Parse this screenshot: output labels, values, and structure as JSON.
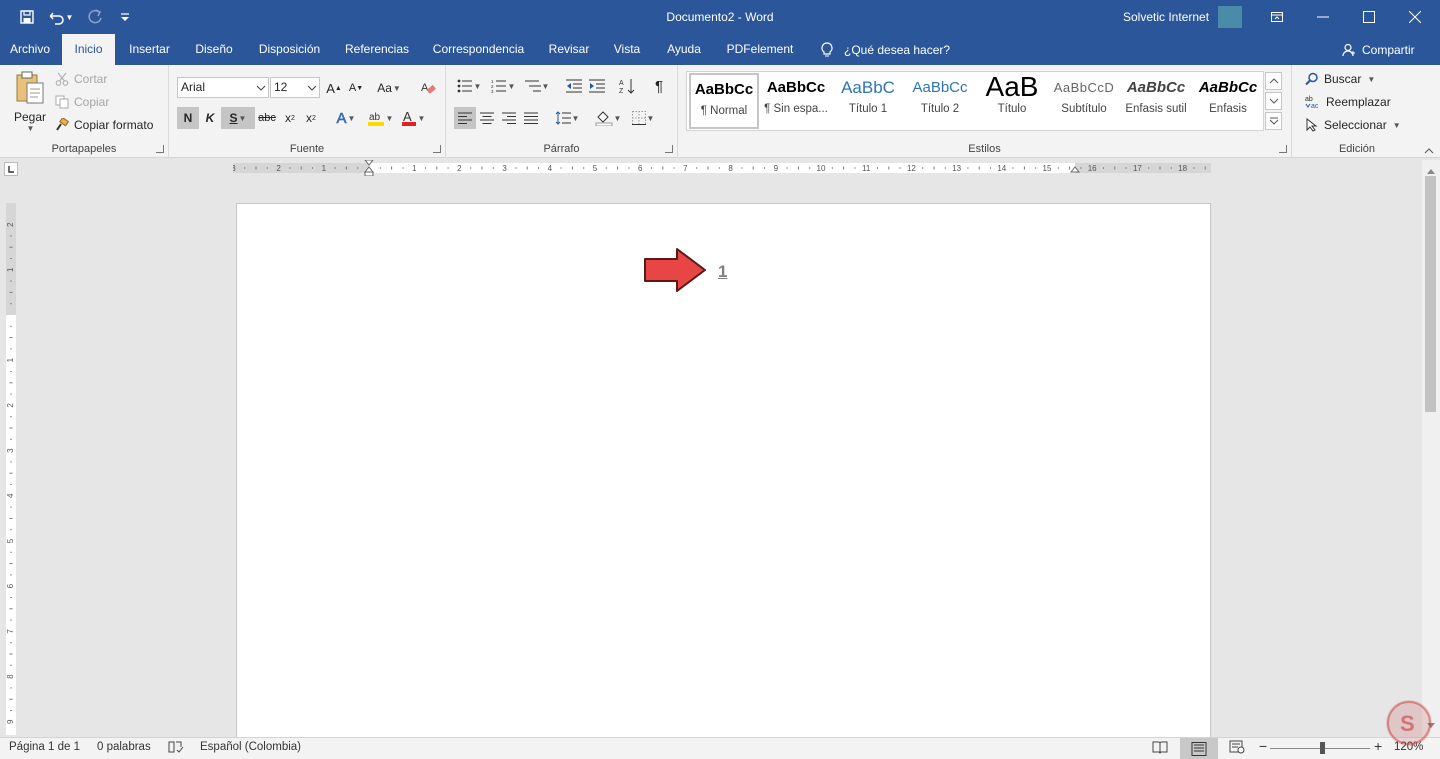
{
  "window": {
    "title": "Documento2 - Word",
    "user": "Solvetic Internet"
  },
  "tabs": [
    "Archivo",
    "Inicio",
    "Insertar",
    "Diseño",
    "Disposición",
    "Referencias",
    "Correspondencia",
    "Revisar",
    "Vista",
    "Ayuda",
    "PDFelement"
  ],
  "active_tab": "Inicio",
  "tell_me": "¿Qué desea hacer?",
  "share": "Compartir",
  "clipboard": {
    "paste": "Pegar",
    "cut": "Cortar",
    "copy": "Copiar",
    "format_painter": "Copiar formato",
    "label": "Portapapeles"
  },
  "font": {
    "name": "Arial",
    "size": "12",
    "grow": "A",
    "shrink": "A",
    "case": "Aa",
    "bold": "N",
    "italic": "K",
    "underline": "S",
    "strike": "abc",
    "sub": "x",
    "sup": "x",
    "sub_mark": "2",
    "sup_mark": "2",
    "effect_letter": "A",
    "color_letter": "A",
    "label": "Fuente"
  },
  "paragraph": {
    "pilcrow": "¶",
    "label": "Párrafo"
  },
  "styles": {
    "items": [
      {
        "sample": "AaBbCc",
        "name": "¶ Normal"
      },
      {
        "sample": "AaBbCc",
        "name": "¶ Sin espa..."
      },
      {
        "sample": "AaBbC",
        "name": "Título 1"
      },
      {
        "sample": "AaBbCc",
        "name": "Título 2"
      },
      {
        "sample": "AaB",
        "name": "Título"
      },
      {
        "sample": "AaBbCcD",
        "name": "Subtítulo"
      },
      {
        "sample": "AaBbCc",
        "name": "Énfasis sutil"
      },
      {
        "sample": "AaBbCc",
        "name": "Énfasis"
      }
    ],
    "label": "Estilos"
  },
  "editing": {
    "find": "Buscar",
    "replace": "Reemplazar",
    "select": "Seleccionar",
    "label": "Edición"
  },
  "ruler": {
    "h_labels": [
      "3",
      "2",
      "1",
      "1",
      "2",
      "3",
      "4",
      "5",
      "6",
      "7",
      "8",
      "9",
      "10",
      "11",
      "12",
      "13",
      "14",
      "15",
      "16",
      "17",
      "18"
    ],
    "v_labels": [
      "2",
      "1",
      "1",
      "2",
      "3",
      "4",
      "5",
      "6",
      "7",
      "8",
      "9"
    ]
  },
  "document": {
    "page_number": "1"
  },
  "status": {
    "page": "Página 1 de 1",
    "words": "0 palabras",
    "language": "Español (Colombia)",
    "zoom": "120%"
  },
  "colors": {
    "accent": "#2b579a",
    "arrow": "#e84545",
    "highlight": "#ffd800",
    "font_color": "#e0221e"
  },
  "icons": [
    "save-icon",
    "undo-icon",
    "redo-icon",
    "customize-icon",
    "ribbon-display-icon",
    "minimize-icon",
    "maximize-icon",
    "close-icon",
    "lightbulb-icon",
    "person-icon",
    "paste-icon",
    "scissors-icon",
    "copy-icon",
    "brush-icon",
    "eraser-icon",
    "search-icon",
    "replace-icon",
    "cursor-icon",
    "proofing-icon",
    "read-mode-icon",
    "print-layout-icon",
    "web-layout-icon"
  ]
}
